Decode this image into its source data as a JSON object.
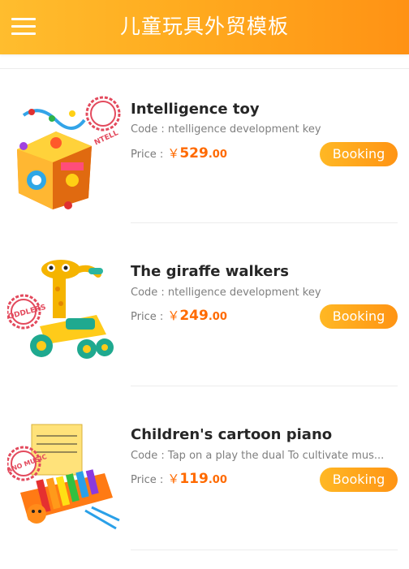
{
  "header": {
    "title": "儿童玩具外贸模板",
    "menu_icon": "hamburger-menu-icon"
  },
  "colors": {
    "header_start": "#ffbd2e",
    "header_end": "#ff9214",
    "price": "#ff6a00",
    "button": "#ffa41c"
  },
  "products": [
    {
      "name": "Intelligence toy",
      "code": "Code : ntelligence development key",
      "price_label": "Price :",
      "currency": "￥",
      "price_int": "529",
      "price_dec": ".00",
      "button": "Booking",
      "image": "activity-cube-toy-image",
      "badge_text": "NTELL"
    },
    {
      "name": "The giraffe walkers",
      "code": "Code : ntelligence development key",
      "price_label": "Price :",
      "currency": "￥",
      "price_int": "249",
      "price_dec": ".00",
      "button": "Booking",
      "image": "giraffe-walker-toy-image",
      "badge_text": "ODDLERS"
    },
    {
      "name": "Children's cartoon piano",
      "code": "Code : Tap on a play the dual To cultivate mus...",
      "price_label": "Price :",
      "currency": "￥",
      "price_int": "119",
      "price_dec": ".00",
      "button": "Booking",
      "image": "cartoon-piano-toy-image",
      "badge_text": "ANO MUSIC"
    }
  ]
}
